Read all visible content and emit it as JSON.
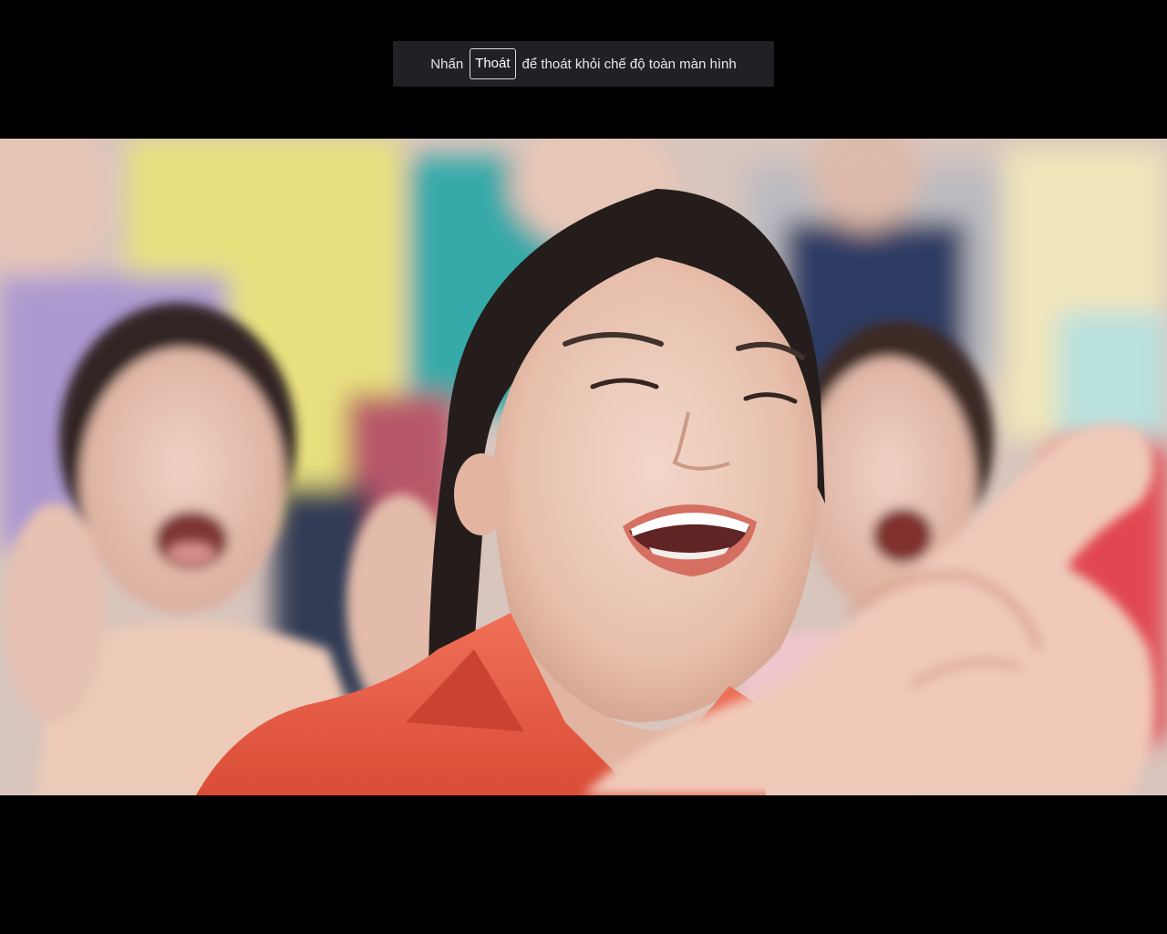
{
  "fullscreen_hint": {
    "prefix": "Nhấn",
    "key_label": "Thoát",
    "suffix": "để thoát khỏi chế độ toàn màn hình"
  },
  "video": {
    "content": "video-frame"
  },
  "colors": {
    "page_background": "#000000",
    "hint_background": "#202124",
    "hint_text": "#e8eaed"
  }
}
